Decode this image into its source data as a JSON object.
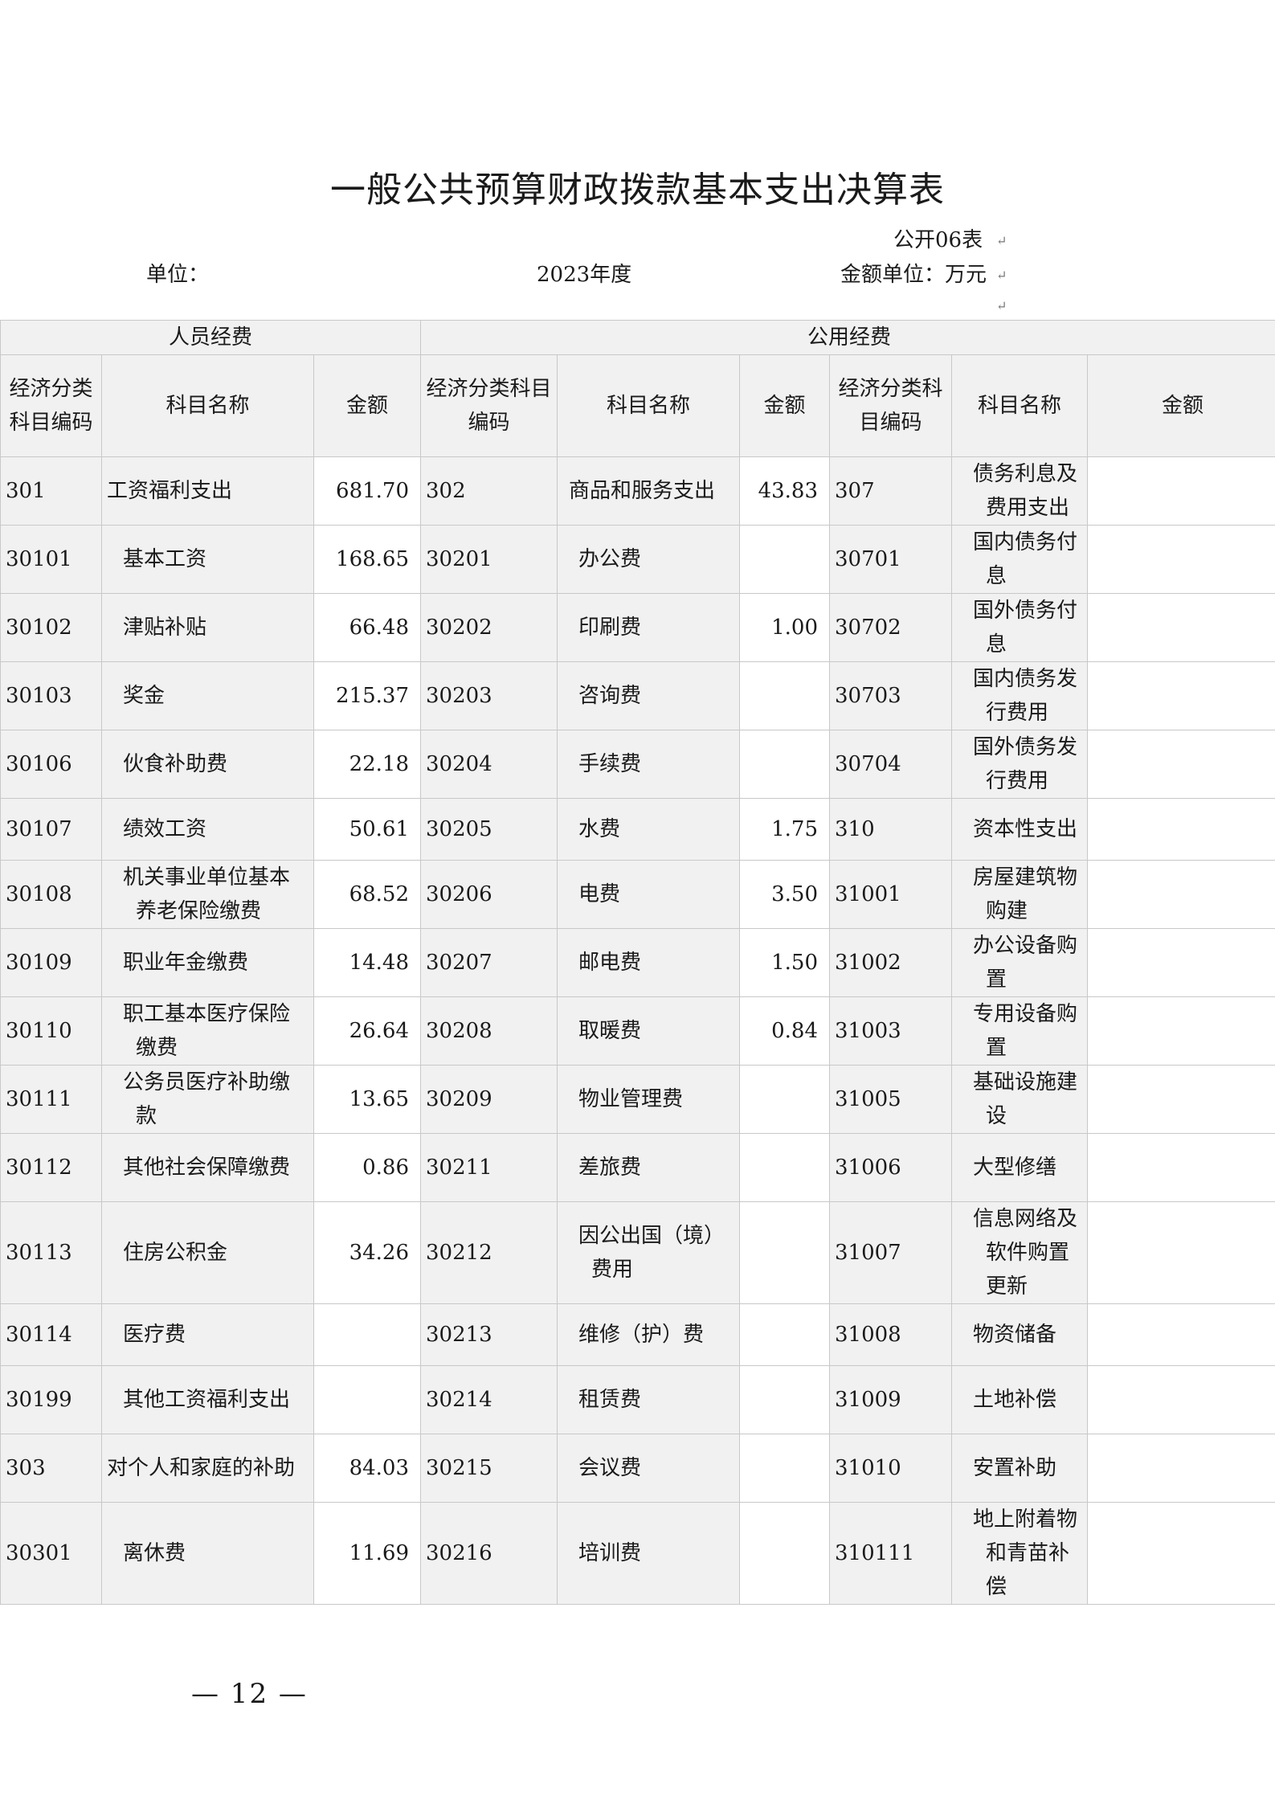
{
  "title": "一般公共预算财政拨款基本支出决算表",
  "form_no": "公开06表",
  "unit_label": "单位：",
  "year": "2023年度",
  "amount_unit": "金额单位：万元",
  "sections": {
    "personnel": "人员经费",
    "public": "公用经费"
  },
  "headers": {
    "code_a": "经济分类科目编码",
    "name_a": "科目名称",
    "amt_a": "金额",
    "code_b": "经济分类科目编码",
    "name_b": "科目名称",
    "amt_b": "金额",
    "code_c": "经济分类科目编码",
    "name_c": "科目名称",
    "amt_c": "金额"
  },
  "rows": [
    {
      "c1": "301",
      "n1": "工资福利支出",
      "a1": "681.70",
      "c2": "302",
      "n2": "商品和服务支出",
      "a2": "43.83",
      "c3": "307",
      "n3": "债务利息及费用支出",
      "a3": ""
    },
    {
      "c1": "30101",
      "n1": "基本工资",
      "a1": "168.65",
      "c2": "30201",
      "n2": "办公费",
      "a2": "",
      "c3": "30701",
      "n3": "国内债务付息",
      "a3": ""
    },
    {
      "c1": "30102",
      "n1": "津贴补贴",
      "a1": "66.48",
      "c2": "30202",
      "n2": "印刷费",
      "a2": "1.00",
      "c3": "30702",
      "n3": "国外债务付息",
      "a3": ""
    },
    {
      "c1": "30103",
      "n1": "奖金",
      "a1": "215.37",
      "c2": "30203",
      "n2": "咨询费",
      "a2": "",
      "c3": "30703",
      "n3": "国内债务发行费用",
      "a3": ""
    },
    {
      "c1": "30106",
      "n1": "伙食补助费",
      "a1": "22.18",
      "c2": "30204",
      "n2": "手续费",
      "a2": "",
      "c3": "30704",
      "n3": "国外债务发行费用",
      "a3": ""
    },
    {
      "c1": "30107",
      "n1": "绩效工资",
      "a1": "50.61",
      "c2": "30205",
      "n2": "水费",
      "a2": "1.75",
      "c3": "310",
      "n3": "资本性支出",
      "a3": ""
    },
    {
      "c1": "30108",
      "n1": "机关事业单位基本养老保险缴费",
      "a1": "68.52",
      "c2": "30206",
      "n2": "电费",
      "a2": "3.50",
      "c3": "31001",
      "n3": "房屋建筑物购建",
      "a3": ""
    },
    {
      "c1": "30109",
      "n1": "职业年金缴费",
      "a1": "14.48",
      "c2": "30207",
      "n2": "邮电费",
      "a2": "1.50",
      "c3": "31002",
      "n3": "办公设备购置",
      "a3": ""
    },
    {
      "c1": "30110",
      "n1": "职工基本医疗保险缴费",
      "a1": "26.64",
      "c2": "30208",
      "n2": "取暖费",
      "a2": "0.84",
      "c3": "31003",
      "n3": "专用设备购置",
      "a3": ""
    },
    {
      "c1": "30111",
      "n1": "公务员医疗补助缴款",
      "a1": "13.65",
      "c2": "30209",
      "n2": "物业管理费",
      "a2": "",
      "c3": "31005",
      "n3": "基础设施建设",
      "a3": ""
    },
    {
      "c1": "30112",
      "n1": "其他社会保障缴费",
      "a1": "0.86",
      "c2": "30211",
      "n2": "差旅费",
      "a2": "",
      "c3": "31006",
      "n3": "大型修缮",
      "a3": ""
    },
    {
      "c1": "30113",
      "n1": "住房公积金",
      "a1": "34.26",
      "c2": "30212",
      "n2": "因公出国（境）费用",
      "a2": "",
      "c3": "31007",
      "n3": "信息网络及软件购置更新",
      "a3": ""
    },
    {
      "c1": "30114",
      "n1": "医疗费",
      "a1": "",
      "c2": "30213",
      "n2": "维修（护）费",
      "a2": "",
      "c3": "31008",
      "n3": "物资储备",
      "a3": ""
    },
    {
      "c1": "30199",
      "n1": "其他工资福利支出",
      "a1": "",
      "c2": "30214",
      "n2": "租赁费",
      "a2": "",
      "c3": "31009",
      "n3": "土地补偿",
      "a3": ""
    },
    {
      "c1": "303",
      "n1": "对个人和家庭的补助",
      "a1": "84.03",
      "c2": "30215",
      "n2": "会议费",
      "a2": "",
      "c3": "31010",
      "n3": "安置补助",
      "a3": ""
    },
    {
      "c1": "30301",
      "n1": "离休费",
      "a1": "11.69",
      "c2": "30216",
      "n2": "培训费",
      "a2": "",
      "c3": "310111",
      "n3": "地上附着物和青苗补偿",
      "a3": ""
    }
  ],
  "page_number": "— 12 —"
}
